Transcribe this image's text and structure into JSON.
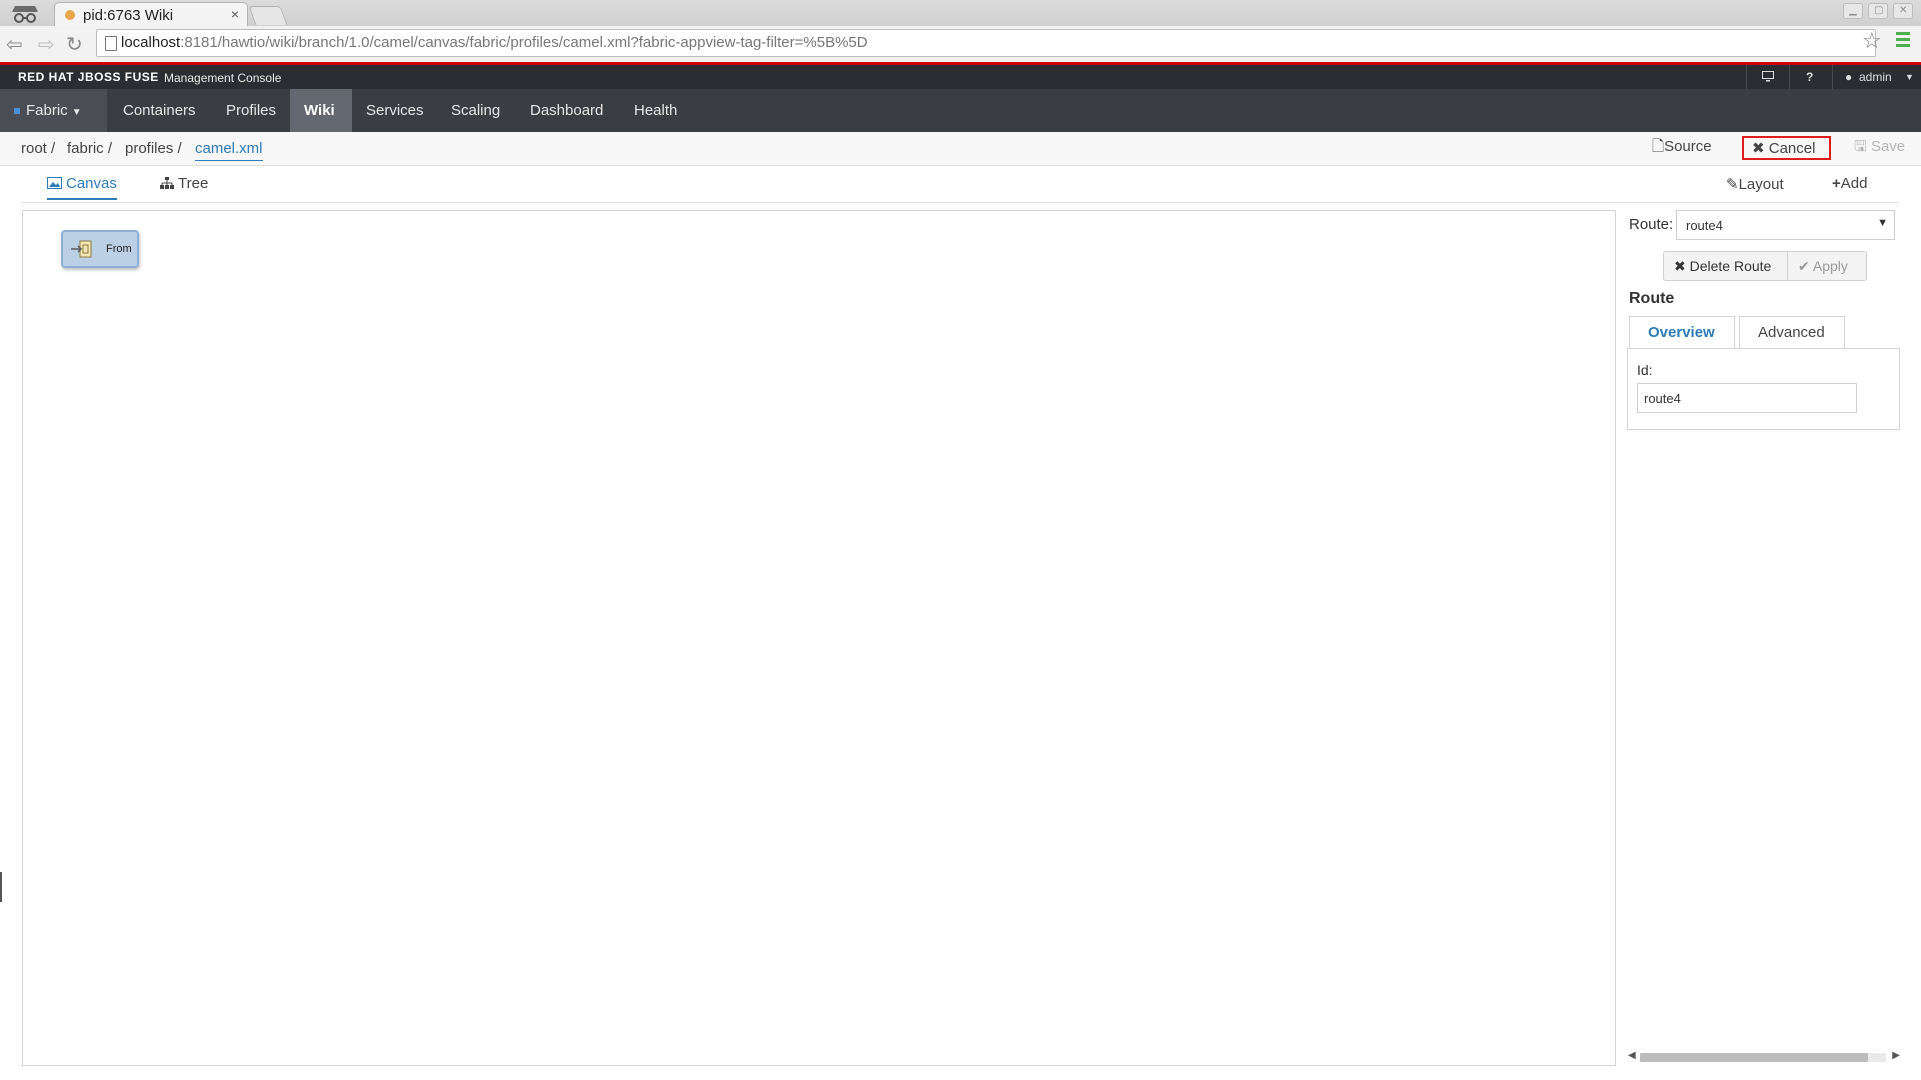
{
  "browser": {
    "tab_title": "pid:6763 Wiki",
    "tab_close": "×",
    "url_host": "localhost",
    "url_rest": ":8181/hawtio/wiki/branch/1.0/camel/canvas/fabric/profiles/camel.xml?fabric-appview-tag-filter=%5B%5D",
    "star": "☆"
  },
  "brand": {
    "name": "RED HAT JBOSS FUSE",
    "subtitle": "Management Console",
    "user": "admin"
  },
  "nav": {
    "fabric": "Fabric",
    "items": [
      "Containers",
      "Profiles",
      "Wiki",
      "Services",
      "Scaling",
      "Dashboard",
      "Health"
    ],
    "active": "Wiki"
  },
  "breadcrumb": {
    "root": "root /",
    "fabric": "fabric /",
    "profiles": "profiles /",
    "file": "camel.xml"
  },
  "actions": {
    "source": "Source",
    "cancel": "Cancel",
    "save": "Save"
  },
  "subtabs": {
    "canvas": "Canvas",
    "tree": "Tree",
    "layout": "Layout",
    "add": "Add"
  },
  "canvas": {
    "node_label": "From"
  },
  "panel": {
    "route_label": "Route:",
    "route_value": "route4",
    "delete_route": "Delete Route",
    "apply": "Apply",
    "section_title": "Route",
    "tab_overview": "Overview",
    "tab_advanced": "Advanced",
    "id_label": "Id:",
    "id_value": "route4"
  },
  "colors": {
    "accent": "#2e7bb8",
    "brand_red": "#cc0000",
    "highlight_border": "#e01b1b",
    "nav_bg": "#3a3d42"
  }
}
